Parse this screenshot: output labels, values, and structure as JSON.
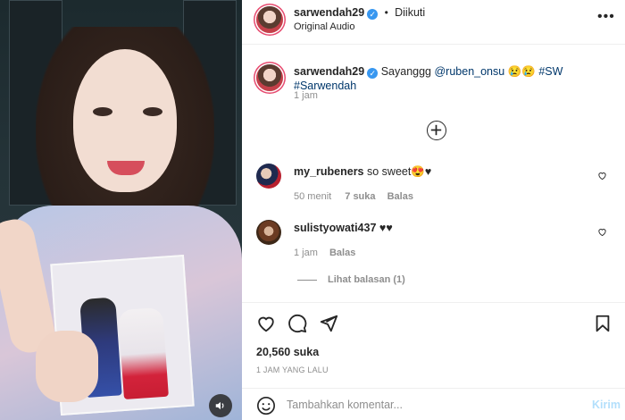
{
  "post": {
    "username": "sarwendah29",
    "follow_status": "Diikuti",
    "audio": "Original Audio",
    "more_icon": "more-horizontal-icon"
  },
  "caption": {
    "username": "sarwendah29",
    "text_prefix": "Sayanggg ",
    "mention": "@ruben_onsu",
    "emojis": "😢😢",
    "hashtags": "#SW #Sarwendah",
    "time": "1 jam"
  },
  "comments": [
    {
      "username": "my_rubeners",
      "text": "so sweet😍♥",
      "time": "50 menit",
      "likes": "7 suka",
      "reply": "Balas"
    },
    {
      "username": "sulistyowati437",
      "text": "♥♥",
      "time": "1 jam",
      "reply": "Balas",
      "view_replies": "Lihat balasan (1)"
    }
  ],
  "actions": {
    "likes": "20,560 suka",
    "timestamp": "1 JAM YANG LALU"
  },
  "composer": {
    "placeholder": "Tambahkan komentar...",
    "post_label": "Kirim"
  },
  "colors": {
    "accent": "#0095f6",
    "verified": "#3897f0",
    "link": "#00376b",
    "muted": "#8e8e8e"
  }
}
